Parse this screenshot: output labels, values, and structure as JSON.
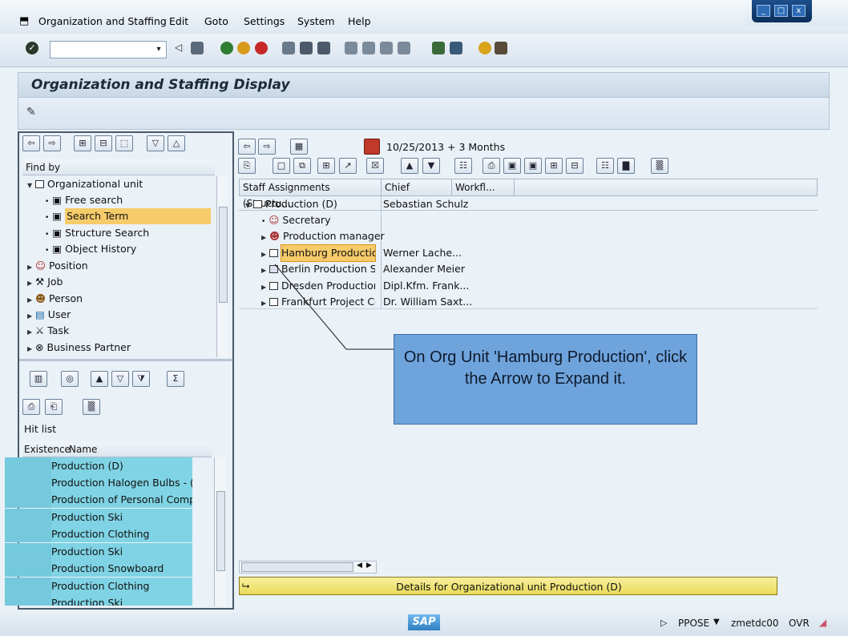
{
  "menu": {
    "items": [
      "Organization and Staffing",
      "Edit",
      "Goto",
      "Settings",
      "System",
      "Help"
    ]
  },
  "window": {
    "title": "Organization and Staffing Display"
  },
  "left": {
    "find_by_label": "Find by",
    "tree": [
      {
        "label": "Organizational unit",
        "type": "folder"
      },
      {
        "label": "Free search",
        "type": "search"
      },
      {
        "label": "Search Term",
        "type": "search",
        "selected": true
      },
      {
        "label": "Structure Search",
        "type": "search"
      },
      {
        "label": "Object History",
        "type": "search"
      },
      {
        "label": "Position",
        "type": "position"
      },
      {
        "label": "Job",
        "type": "job"
      },
      {
        "label": "Person",
        "type": "person"
      },
      {
        "label": "User",
        "type": "user"
      },
      {
        "label": "Task",
        "type": "task"
      },
      {
        "label": "Business Partner",
        "type": "partner"
      }
    ],
    "hitlist_label": "Hit list",
    "hitlist_headers": {
      "existence": "Existence",
      "name": "Name"
    },
    "hitlist_rows": [
      "Production (D)",
      "Production Halogen Bulbs - (D)",
      "Production of Personal Computi",
      "Production Ski",
      "Production Clothing",
      "Production Ski",
      "Production Snowboard",
      "Production Clothing",
      "Production Ski"
    ]
  },
  "right": {
    "date_range": "10/25/2013 + 3 Months",
    "columns": [
      "Staff Assignments (Structu...",
      "Chief",
      "Workfl..."
    ],
    "rows": [
      {
        "name": "Production (D)",
        "chief": "Sebastian Schulz"
      },
      {
        "name": "Secretary",
        "chief": ""
      },
      {
        "name": "Production manager",
        "chief": ""
      },
      {
        "name": "Hamburg Production",
        "chief": "Werner Lache..."
      },
      {
        "name": "Berlin Production Site",
        "chief": "Alexander Meier"
      },
      {
        "name": "Dresden Production S",
        "chief": "Dipl.Kfm. Frank..."
      },
      {
        "name": "Frankfurt Project Cen",
        "chief": "Dr. William Saxt..."
      }
    ],
    "details_label": "Details for Organizational unit Production (D)"
  },
  "callout": {
    "text": "On Org Unit 'Hamburg Production', click the Arrow to Expand it."
  },
  "status": {
    "logo": "SAP",
    "program": "PPOSE",
    "server": "zmetdc00",
    "mode": "OVR"
  },
  "colors": {
    "hitlist_row": "#7fd3e4",
    "selection": "#f6cb6a",
    "callout": "#6fa3dc",
    "details": "#eadb5a"
  }
}
